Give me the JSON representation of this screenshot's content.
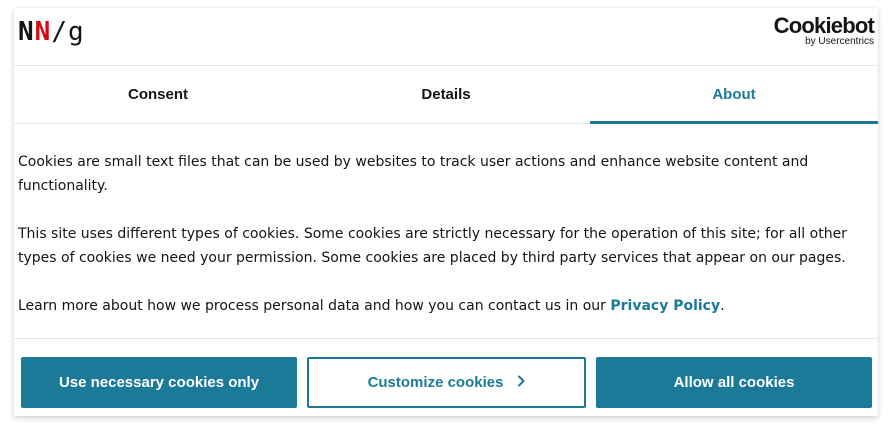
{
  "header": {
    "logo": {
      "n1": "N",
      "n2": "N",
      "slash": "/",
      "g": "g"
    },
    "provider_logo": {
      "main": "Cookiebot",
      "sub": "by Usercentrics"
    }
  },
  "tabs": [
    {
      "label": "Consent",
      "active": false
    },
    {
      "label": "Details",
      "active": false
    },
    {
      "label": "About",
      "active": true
    }
  ],
  "content": {
    "paragraph1": "Cookies are small text files that can be used by websites to track user actions and enhance website content and functionality.",
    "paragraph2": "This site uses different types of cookies. Some cookies are strictly necessary for the operation of this site; for all other types of cookies we need your permission. Some cookies are placed by third party services that appear on our pages.",
    "paragraph3_prefix": "Learn more about how we process personal data and how you can contact us in our ",
    "privacy_link": "Privacy Policy",
    "paragraph3_suffix": "."
  },
  "buttons": {
    "necessary": "Use necessary cookies only",
    "customize": "Customize cookies",
    "customize_icon": "chevron-right-icon",
    "allow": "Allow all cookies"
  },
  "colors": {
    "accent": "#1b7a98",
    "brand_red": "#d20a11",
    "text": "#141414"
  }
}
